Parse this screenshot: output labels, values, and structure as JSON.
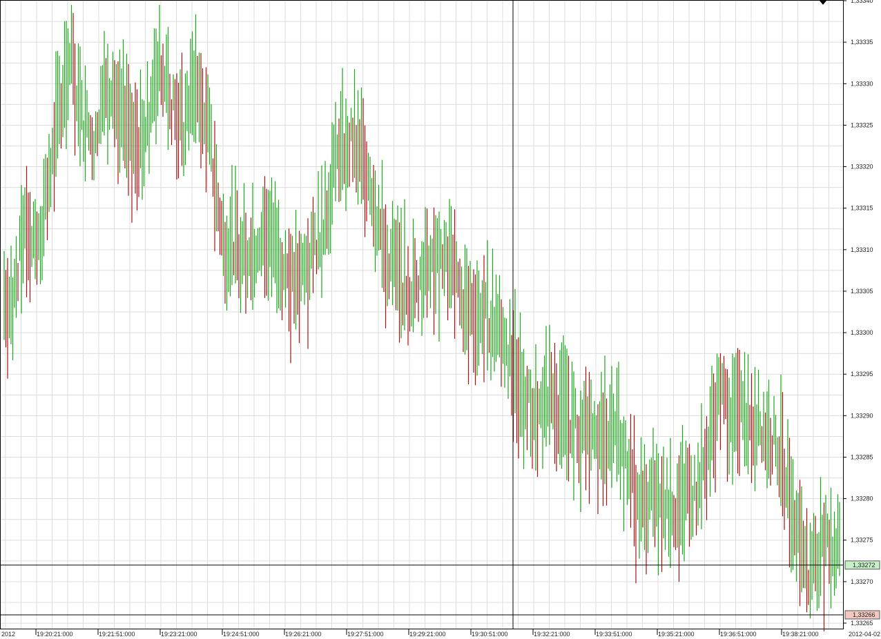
{
  "colors": {
    "background": "#ffffff",
    "grid": "#dcdcdc",
    "axis": "#000000",
    "up_bar": "#17a817",
    "down_bar": "#a81010",
    "crosshair": "#000000",
    "bid_label_bg": "#c8f0c8",
    "ask_label_bg": "#f2c8c0"
  },
  "chart_data": {
    "type": "ohlc-tick",
    "title": "",
    "xlabel": "",
    "ylabel": "",
    "ylim": [
      1.33264,
      1.3334
    ],
    "grid": true,
    "y_ticks": [
      1.3334,
      1.33335,
      1.3333,
      1.33325,
      1.3332,
      1.33315,
      1.3331,
      1.33305,
      1.333,
      1.33295,
      1.3329,
      1.33285,
      1.3328,
      1.33275,
      1.3327,
      1.33265
    ],
    "y_tick_labels": [
      "1,33340",
      "1,33335",
      "1,33330",
      "1,33325",
      "1,33320",
      "1,33315",
      "1,33310",
      "1,33305",
      "1,33300",
      "1,33295",
      "1,33290",
      "1,33285",
      "1,33280",
      "1,33275",
      "1,33270",
      "1,33265"
    ],
    "x_tick_labels": [
      "2012",
      "19:20:21:000",
      "19:21:51:000",
      "19:23:21:000",
      "19:24:51:000",
      "19:26:21:000",
      "19:27:51:000",
      "19:29:21:000",
      "19:30:51:000",
      "19:32:21:000",
      "19:33:51:000",
      "19:35:21:000",
      "19:36:51:000",
      "19:38:21:000",
      "2012-04-02"
    ],
    "bid_price": 1.33272,
    "bid_label": "1,33272",
    "ask_price": 1.33266,
    "ask_label": "1,33266",
    "crosshair_time": "19:31:51",
    "price_path": [
      [
        "19:19:16",
        1.33307
      ],
      [
        "19:19:45",
        1.33303
      ],
      [
        "19:20:06",
        1.33314
      ],
      [
        "19:20:20",
        1.33309
      ],
      [
        "19:20:40",
        1.33318
      ],
      [
        "19:20:55",
        1.33328
      ],
      [
        "19:21:10",
        1.33333
      ],
      [
        "19:21:25",
        1.33326
      ],
      [
        "19:21:45",
        1.33323
      ],
      [
        "19:22:05",
        1.3333
      ],
      [
        "19:22:25",
        1.33326
      ],
      [
        "19:22:45",
        1.33322
      ],
      [
        "19:23:05",
        1.33326
      ],
      [
        "19:23:20",
        1.33333
      ],
      [
        "19:23:35",
        1.33328
      ],
      [
        "19:23:55",
        1.33324
      ],
      [
        "19:24:10",
        1.3333
      ],
      [
        "19:24:30",
        1.33324
      ],
      [
        "19:24:51",
        1.33311
      ],
      [
        "19:25:30",
        1.3331
      ],
      [
        "19:26:00",
        1.33312
      ],
      [
        "19:26:30",
        1.33306
      ],
      [
        "19:27:00",
        1.33309
      ],
      [
        "19:27:20",
        1.33315
      ],
      [
        "19:27:40",
        1.33322
      ],
      [
        "19:28:00",
        1.33323
      ],
      [
        "19:28:20",
        1.3332
      ],
      [
        "19:28:45",
        1.3331
      ],
      [
        "19:29:10",
        1.33306
      ],
      [
        "19:29:30",
        1.33305
      ],
      [
        "19:29:50",
        1.33309
      ],
      [
        "19:30:20",
        1.33308
      ],
      [
        "19:30:40",
        1.33303
      ],
      [
        "19:31:05",
        1.33302
      ],
      [
        "19:31:30",
        1.33301
      ],
      [
        "19:31:51",
        1.33296
      ],
      [
        "19:32:20",
        1.3329
      ],
      [
        "19:32:50",
        1.33292
      ],
      [
        "19:33:20",
        1.33289
      ],
      [
        "19:33:50",
        1.33286
      ],
      [
        "19:34:20",
        1.33289
      ],
      [
        "19:34:50",
        1.33279
      ],
      [
        "19:35:20",
        1.3328
      ],
      [
        "19:35:50",
        1.33279
      ],
      [
        "19:36:20",
        1.33281
      ],
      [
        "19:36:50",
        1.33292
      ],
      [
        "19:37:20",
        1.3329
      ],
      [
        "19:37:50",
        1.33289
      ],
      [
        "19:38:10",
        1.33287
      ],
      [
        "19:38:30",
        1.33282
      ],
      [
        "19:38:50",
        1.33275
      ],
      [
        "19:39:00",
        1.3327
      ],
      [
        "19:39:15",
        1.33274
      ]
    ]
  }
}
